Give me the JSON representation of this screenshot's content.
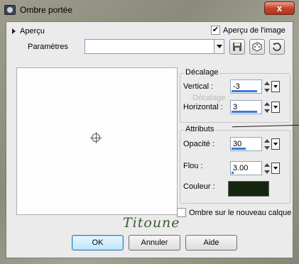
{
  "window": {
    "title": "Ombre portée",
    "close_glyph": "x"
  },
  "preview": {
    "toggle_label": "Aperçu",
    "image_preview_label": "Aperçu de l'image",
    "image_preview_checked": true
  },
  "params": {
    "label": "Paramètres",
    "value": ""
  },
  "toolbar": {
    "icons": [
      "save-icon",
      "random-icon",
      "reset-icon"
    ]
  },
  "decalage": {
    "title": "Décalage",
    "vertical_label": "Vertical :",
    "vertical_value": "-3",
    "vertical_fill": 0.85,
    "horizontal_label": "Horizontal :",
    "horizontal_value": "3",
    "horizontal_fill": 0.85
  },
  "attributs": {
    "title": "Attributs",
    "opacity_label": "Opacité :",
    "opacity_value": "30",
    "opacity_fill": 0.3,
    "blur_label": "Flou :",
    "blur_value": "3.00",
    "blur_fill": 0.05,
    "color_label": "Couleur :",
    "color_value": "#15260f"
  },
  "layer_option": {
    "label": "Ombre sur le nouveau calque",
    "checked": false
  },
  "buttons": {
    "ok": "OK",
    "cancel": "Annuler",
    "help": "Aide"
  },
  "signature": "Titoune",
  "ghost": "Décalage :"
}
